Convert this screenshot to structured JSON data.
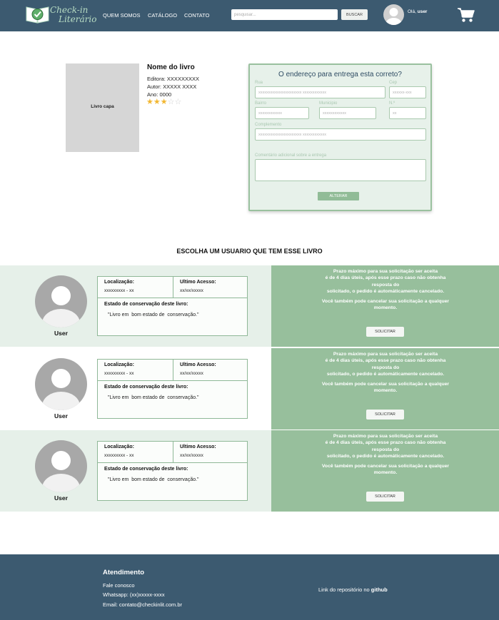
{
  "header": {
    "logo_line1": "Check-in",
    "logo_line2": "Literário",
    "nav": [
      "QUEM SOMOS",
      "CATÁLOGO",
      "CONTATO"
    ],
    "search_placeholder": "pesquisar...",
    "search_button": "BUSCAR",
    "greeting_prefix": "Olá, ",
    "greeting_user": "user"
  },
  "book": {
    "cover_label": "Livro capa",
    "title": "Nome do livro",
    "publisher": "Editora: XXXXXXXXX",
    "author": "Autor: XXXXX XXXX",
    "year": "Ano: 0000",
    "rating": 3,
    "rating_max": 5
  },
  "address_form": {
    "title": "O endereço para entrega esta correto?",
    "fields": {
      "rua": {
        "label": "Rua",
        "placeholder": "xxxxxxxxxxxxxxxxxxxxxx xxxxxxxxxxxx"
      },
      "cep": {
        "label": "Cep",
        "placeholder": "xxxxxx-xxx"
      },
      "bairro": {
        "label": "Bairro",
        "placeholder": "xxxxxxxxxxxx"
      },
      "municipio": {
        "label": "Municipio",
        "placeholder": "xxxxxxxxxxxx"
      },
      "numero": {
        "label": "N.º",
        "placeholder": "xx"
      },
      "complemento": {
        "label": "Complemento",
        "placeholder": "xxxxxxxxxxxxxxxxxxxxxx xxxxxxxxxxxx"
      },
      "comentario": {
        "label": "Comentário adicional sobre a entrega",
        "placeholder": ""
      }
    },
    "submit_label": "ALTERAR"
  },
  "section_title": "ESCOLHA UM USUARIO QUE TEM ESSE LIVRO",
  "users": [
    {
      "name": "User",
      "location_label": "Localização:",
      "location_value": "xxxxxxxxx - xx",
      "access_label": "Ultimo Acesso:",
      "access_value": "xx/xx/xxxxx",
      "condition_label": "Estado de conservação deste livro:",
      "condition_value": "\"Livro em  bom estado de  conservação.\"",
      "notice_1": "Prazo máximo para sua solicitação ser aceita",
      "notice_2": "é de 4 dias úteis, após esse prazo caso não obtenha",
      "notice_3": "resposta do",
      "notice_4": "solicitado, o pedido é automáticamente cancelado.",
      "notice_5": "Você também pode cancelar sua solicitação a qualquer",
      "notice_6": "momento.",
      "button": "SOLICITAR"
    },
    {
      "name": "User",
      "location_label": "Localização:",
      "location_value": "xxxxxxxxx - xx",
      "access_label": "Ultimo Acesso:",
      "access_value": "xx/xx/xxxxx",
      "condition_label": "Estado de conservação deste livro:",
      "condition_value": "\"Livro em  bom estado de  conservação.\"",
      "notice_1": "Prazo máximo para sua solicitação ser aceita",
      "notice_2": "é de 4 dias úteis, após esse prazo caso não obtenha",
      "notice_3": "resposta do",
      "notice_4": "solicitado, o pedido é automáticamente cancelado.",
      "notice_5": "Você também pode cancelar sua solicitação a qualquer",
      "notice_6": "momento.",
      "button": "SOLICITAR"
    },
    {
      "name": "User",
      "location_label": "Localização:",
      "location_value": "xxxxxxxxx - xx",
      "access_label": "Ultimo Acesso:",
      "access_value": "xx/xx/xxxxx",
      "condition_label": "Estado de conservação deste livro:",
      "condition_value": "\"Livro em  bom estado de  conservação.\"",
      "notice_1": "Prazo máximo para sua solicitação ser aceita",
      "notice_2": "é de 4 dias úteis, após esse prazo caso não obtenha",
      "notice_3": "resposta do",
      "notice_4": "solicitado, o pedido é automáticamente cancelado.",
      "notice_5": "Você também pode cancelar sua solicitação a qualquer",
      "notice_6": "momento.",
      "button": "SOLICITAR"
    }
  ],
  "footer": {
    "title": "Atendimento",
    "contact_us": "Fale conosco",
    "whatsapp": "Whatsapp: (xx)xxxxx-xxxx",
    "email": "Email: contato@checkinlit.com.br",
    "repo_prefix": "Link do repositório no ",
    "repo_link": "github"
  },
  "colors": {
    "header_bg": "#3c5a70",
    "accent_green": "#97bf9c",
    "light_green": "#e7f1ea",
    "star": "#f2b731"
  }
}
